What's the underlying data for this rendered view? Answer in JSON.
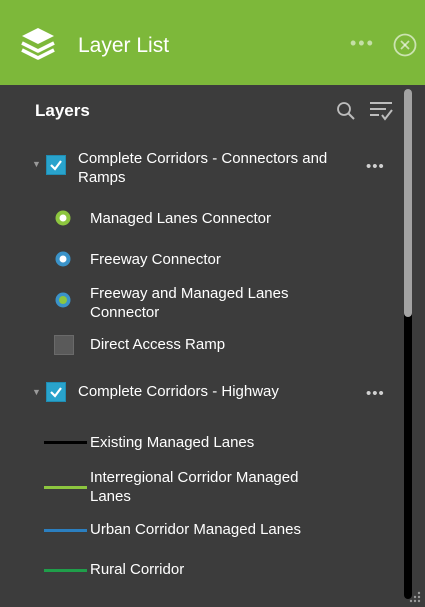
{
  "header": {
    "title": "Layer List",
    "more_icon": "more-horizontal-icon",
    "close_icon": "close-circle-icon",
    "logo_icon": "layers-stack-icon",
    "color": "#7db83a"
  },
  "panel": {
    "heading": "Layers",
    "search_icon": "search-icon",
    "filter_icon": "filter-list-icon"
  },
  "groups": [
    {
      "title": "Complete Corridors - Connectors and Ramps",
      "checked": true,
      "items": [
        {
          "label": "Managed Lanes Connector",
          "symbol": "circle",
          "fill": "#8dc63f",
          "stroke": "#ffffff"
        },
        {
          "label": "Freeway Connector",
          "symbol": "circle",
          "fill": "#3a93c9",
          "stroke": "#ffffff"
        },
        {
          "label": "Freeway and Managed Lanes Connector",
          "symbol": "circle",
          "fill": "#8dc63f",
          "stroke": "#3a93c9"
        },
        {
          "label": "Direct Access Ramp",
          "symbol": "square",
          "fill": "#5a5a5a"
        }
      ]
    },
    {
      "title": "Complete Corridors - Highway",
      "checked": true,
      "items": [
        {
          "label": "Existing Managed Lanes",
          "symbol": "line",
          "color": "#000000"
        },
        {
          "label": "Interregional Corridor Managed Lanes",
          "symbol": "line",
          "color": "#8dc63f"
        },
        {
          "label": "Urban Corridor Managed Lanes",
          "symbol": "line",
          "color": "#2b7fc0"
        },
        {
          "label": "Rural Corridor",
          "symbol": "line",
          "color": "#1f9e4a"
        }
      ]
    }
  ],
  "more_dots": "•••"
}
